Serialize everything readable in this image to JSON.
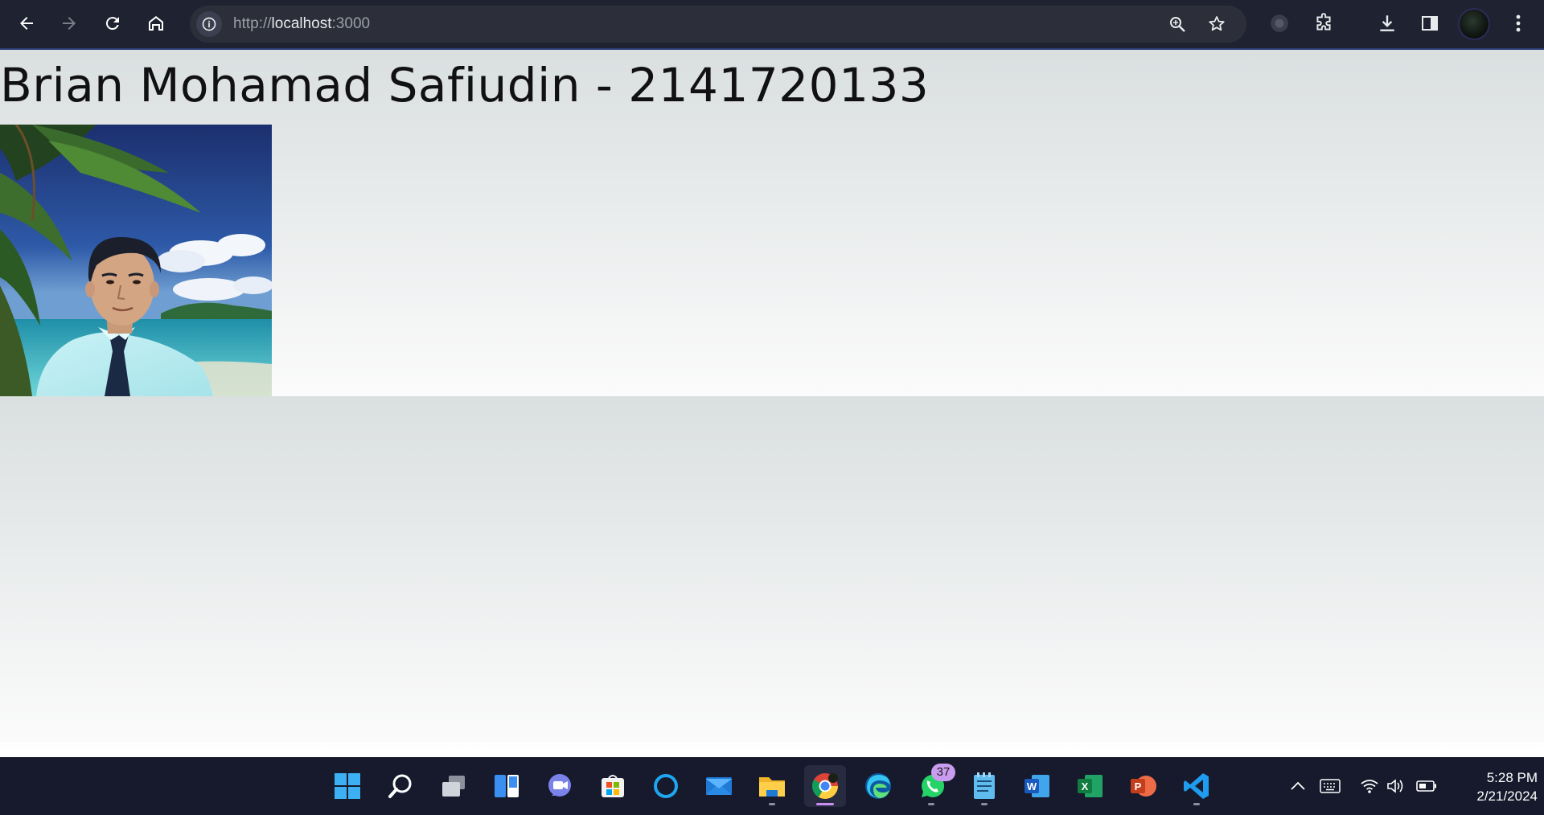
{
  "browser": {
    "url_scheme": "http://",
    "url_host": "localhost",
    "url_port": ":3000"
  },
  "page": {
    "heading": "Brian Mohamad Safiudin - 2141720133"
  },
  "taskbar": {
    "whatsapp_badge": "37",
    "time": "5:28 PM",
    "date": "2/21/2024"
  }
}
